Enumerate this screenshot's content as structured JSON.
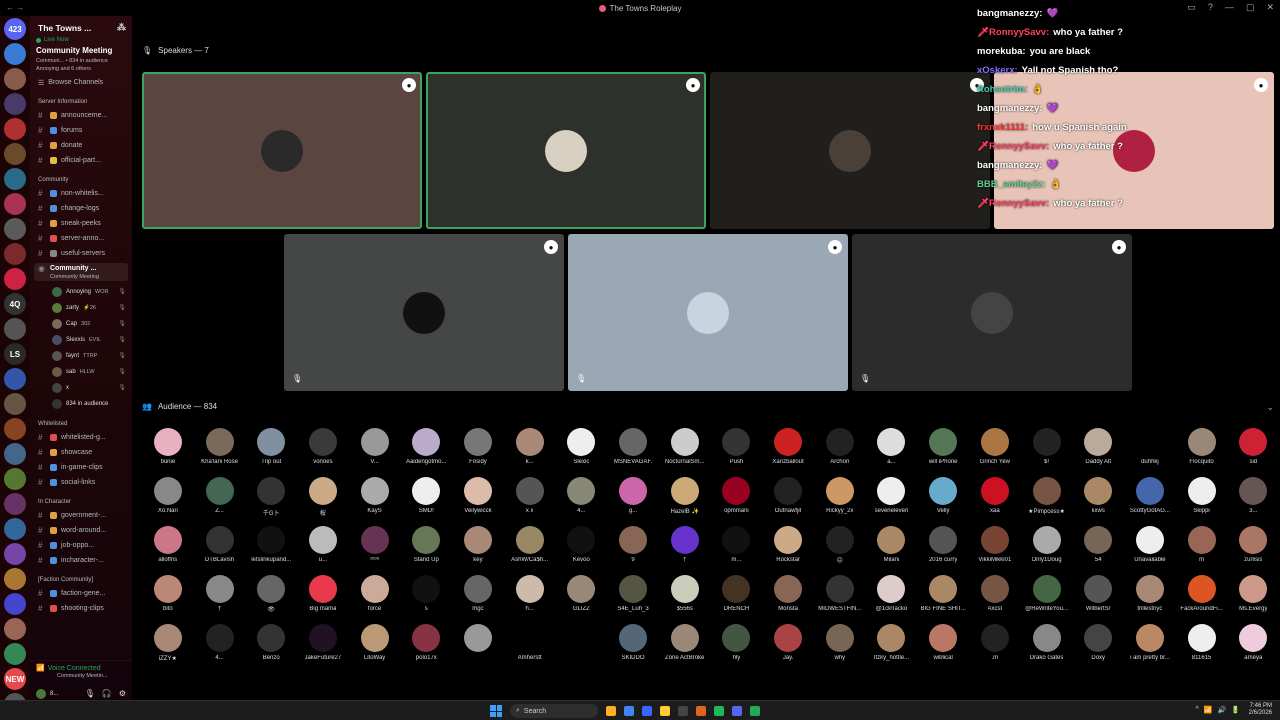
{
  "window": {
    "title": "The Towns Roleplay",
    "back": "←  →",
    "controls": [
      "▭",
      "?",
      "—",
      "▢",
      "✕"
    ]
  },
  "rail": [
    {
      "label": "423",
      "badge": "",
      "color": "#5865f2"
    },
    {
      "label": "",
      "badge": "",
      "color": "#3a7bd5"
    },
    {
      "label": "",
      "badge": "",
      "color": "#8a5a4a"
    },
    {
      "label": "",
      "badge": "",
      "color": "#4a3a6a"
    },
    {
      "label": "",
      "badge": "",
      "color": "#b03030"
    },
    {
      "label": "",
      "badge": "",
      "color": "#6a4a2a"
    },
    {
      "label": "",
      "badge": "",
      "color": "#2a6a8a"
    },
    {
      "label": "",
      "badge": "",
      "color": "#aa3355"
    },
    {
      "label": "",
      "badge": "",
      "color": "#5a5a5a"
    },
    {
      "label": "",
      "badge": "",
      "color": "#7a2a2a"
    },
    {
      "label": "",
      "badge": "",
      "color": "#cc2244"
    },
    {
      "label": "4Q",
      "badge": "",
      "color": "#333333"
    },
    {
      "label": "",
      "badge": "",
      "color": "#555555"
    },
    {
      "label": "LS",
      "badge": "",
      "color": "#2a2a2a"
    },
    {
      "label": "",
      "badge": "",
      "color": "#3355aa"
    },
    {
      "label": "",
      "badge": "",
      "color": "#665544"
    },
    {
      "label": "",
      "badge": "",
      "color": "#884422"
    },
    {
      "label": "",
      "badge": "",
      "color": "#446688"
    },
    {
      "label": "",
      "badge": "",
      "color": "#557733"
    },
    {
      "label": "",
      "badge": "",
      "color": "#663366"
    },
    {
      "label": "",
      "badge": "",
      "color": "#336699"
    },
    {
      "label": "",
      "badge": "",
      "color": "#7744aa"
    },
    {
      "label": "",
      "badge": "",
      "color": "#aa7733"
    },
    {
      "label": "",
      "badge": "",
      "color": "#4444cc"
    },
    {
      "label": "",
      "badge": "",
      "color": "#996655"
    },
    {
      "label": "",
      "badge": "",
      "color": "#338855"
    },
    {
      "label": "NEW",
      "badge": "",
      "color": "#e5484d"
    },
    {
      "label": "",
      "badge": "",
      "color": "#555555"
    }
  ],
  "sidebar": {
    "server_name": "The Towns ...",
    "live_now": "Live Now",
    "event_title": "Community Meeting",
    "event_sub": "Communi... • 834 in audience",
    "event_sub2": "Annoying and 6 others",
    "browse": "Browse Channels",
    "categories": [
      {
        "name": "Server Information",
        "channels": [
          {
            "name": "announceme...",
            "emo": "#e0a040"
          },
          {
            "name": "forums",
            "emo": "#5090e0"
          },
          {
            "name": "donate",
            "emo": "#e0a040"
          },
          {
            "name": "official-part...",
            "emo": "#e0c040"
          }
        ]
      },
      {
        "name": "Community",
        "channels": [
          {
            "name": "non-whitelis...",
            "emo": "#5090e0"
          },
          {
            "name": "change-logs",
            "emo": "#5090e0"
          },
          {
            "name": "sneak-peeks",
            "emo": "#e0a040"
          },
          {
            "name": "server-anno...",
            "emo": "#e05050"
          },
          {
            "name": "useful-servers",
            "emo": "#888888"
          }
        ]
      }
    ],
    "active_channel": {
      "name": "Community ...",
      "sub": "Community Meeting"
    },
    "voice_users": [
      {
        "name": "Annoying",
        "tag": "WOR"
      },
      {
        "name": "zarty",
        "tag": "⚡26"
      },
      {
        "name": "Cap",
        "tag": "302"
      },
      {
        "name": "Slexxis",
        "tag": "EVIL"
      },
      {
        "name": "faynt",
        "tag": "TTRP"
      },
      {
        "name": "sab",
        "tag": "HLLW"
      },
      {
        "name": "x",
        "tag": ""
      }
    ],
    "audience_count": "834 in audience",
    "categories2": [
      {
        "name": "Whitelisted",
        "channels": [
          {
            "name": "whitelisted-g...",
            "emo": "#e05050"
          },
          {
            "name": "showcase",
            "emo": "#e0a040"
          },
          {
            "name": "in-game-clips",
            "emo": "#5090e0"
          },
          {
            "name": "social-links",
            "emo": "#5090e0"
          }
        ]
      },
      {
        "name": "In Character",
        "channels": [
          {
            "name": "government-...",
            "emo": "#e0a040"
          },
          {
            "name": "word-around...",
            "emo": "#e0a040"
          },
          {
            "name": "job-oppo...",
            "emo": "#5090e0"
          },
          {
            "name": "incharacter-...",
            "emo": "#5090e0"
          }
        ]
      },
      {
        "name": "[Faction Community]",
        "channels": [
          {
            "name": "faction-gene...",
            "emo": "#5090e0"
          },
          {
            "name": "shooting-clips",
            "emo": "#e05050"
          }
        ]
      }
    ],
    "voice_connected": "Voice Connected",
    "voice_sub": "Community Meetin...",
    "user_name": "8...",
    "user_ctrls": [
      "🎙",
      "🎧",
      "⚙"
    ]
  },
  "stage": {
    "speakers_header": "Speakers — 7",
    "audience_header": "Audience — 834",
    "tiles": [
      {
        "bg": "#5a4540",
        "border": "#3ba55c",
        "av": "#2a2a2a"
      },
      {
        "bg": "#2e302c",
        "border": "#3ba55c",
        "av": "#d8d0c0"
      },
      {
        "bg": "#211f1b",
        "border": "transparent",
        "av": "#4a4038"
      },
      {
        "bg": "#e8c4b8",
        "border": "transparent",
        "av": "#b02040"
      },
      {
        "bg": "#454646",
        "border": "transparent",
        "av": "#111111"
      },
      {
        "bg": "#9aa7b5",
        "border": "transparent",
        "av": "#c8d4e0"
      },
      {
        "bg": "#2c2c2c",
        "border": "transparent",
        "av": "#444444"
      }
    ]
  },
  "chat": [
    {
      "user": "bangmanezzy:",
      "text": "💜",
      "color": "#ffffff"
    },
    {
      "user": "🗡RonnyySavv:",
      "text": "who ya father ?",
      "color": "#ff4060"
    },
    {
      "user": "morekuba:",
      "text": "you are black",
      "color": "#ffffff"
    },
    {
      "user": "xOskerx:",
      "text": "Yall not Spanish tho?",
      "color": "#8070ff"
    },
    {
      "user": "Rohsotrim:",
      "text": "👌",
      "color": "#40d0b0"
    },
    {
      "user": "bangmanezzy:",
      "text": "💜",
      "color": "#ffffff"
    },
    {
      "user": "frxnxk1111:",
      "text": "how u Spanish again",
      "color": "#ff3030"
    },
    {
      "user": "🗡RonnyySavv:",
      "text": "who ya father ?",
      "color": "#ff4060"
    },
    {
      "user": "bangmanezzy:",
      "text": "💜",
      "color": "#ffffff"
    },
    {
      "user": "BBB_smiley2z:",
      "text": "👌",
      "color": "#60d090"
    },
    {
      "user": "🗡RonnyySavv:",
      "text": "who ya father ?",
      "color": "#ff4060"
    }
  ],
  "audience": [
    [
      {
        "n": "bunie",
        "c": "#e8b0c0"
      },
      {
        "n": "Kha'lani Rose",
        "c": "#7a6a5a"
      },
      {
        "n": "Trip out",
        "c": "#8090a0"
      },
      {
        "n": "vonoes",
        "c": "#3a3a3a"
      },
      {
        "n": "V...",
        "c": "#999999"
      },
      {
        "n": "Aaidengotmo...",
        "c": "#bbaacc"
      },
      {
        "n": "Fosidy",
        "c": "#777777"
      },
      {
        "n": "k...",
        "c": "#aa8877"
      },
      {
        "n": "Slexic",
        "c": "#eeeeee"
      },
      {
        "n": "MSNEVAGAF.",
        "c": "#666666"
      },
      {
        "n": "NocturnalSm...",
        "c": "#cccccc"
      },
      {
        "n": "Push",
        "c": "#333333"
      },
      {
        "n": "Xanzballout",
        "c": "#cc2222"
      },
      {
        "n": "Archon",
        "c": "#222222"
      },
      {
        "n": "a...",
        "c": "#dddddd"
      },
      {
        "n": "will iPhone",
        "c": "#557755"
      },
      {
        "n": "Grinch Yew",
        "c": "#aa7744"
      },
      {
        "n": "$!",
        "c": "#222222"
      },
      {
        "n": "Daddy Alt",
        "c": "#bbaa99"
      },
      {
        "n": "duhhkj",
        "c": "#000000"
      },
      {
        "n": "Flocquito",
        "c": "#998877"
      },
      {
        "n": "sid",
        "c": "#cc2233"
      }
    ],
    [
      {
        "n": "Xo.Nari",
        "c": "#888888"
      },
      {
        "n": "Z...",
        "c": "#446655"
      },
      {
        "n": "千G卜",
        "c": "#333333"
      },
      {
        "n": "桜",
        "c": "#ccaa88"
      },
      {
        "n": "KayS",
        "c": "#aaaaaa"
      },
      {
        "n": "SMD!",
        "c": "#eeeeee"
      },
      {
        "n": "Veilywicck",
        "c": "#ddbbaa"
      },
      {
        "n": "x x",
        "c": "#555555"
      },
      {
        "n": "4...",
        "c": "#888877"
      },
      {
        "n": "g...",
        "c": "#cc66aa"
      },
      {
        "n": "HazelB ✨",
        "c": "#ccaa77"
      },
      {
        "n": "opmmani",
        "c": "#990022"
      },
      {
        "n": "Outnawfjit",
        "c": "#222222"
      },
      {
        "n": "Rickyy_2x",
        "c": "#cc9966"
      },
      {
        "n": "seveneleven",
        "c": "#eeeeee"
      },
      {
        "n": "Velly",
        "c": "#66aacc"
      },
      {
        "n": "xaa",
        "c": "#cc1122"
      },
      {
        "n": "★Pimpcess★",
        "c": "#775544"
      },
      {
        "n": "kxws",
        "c": "#aa8866"
      },
      {
        "n": "ScottyGotAG...",
        "c": "#4466aa"
      },
      {
        "n": "Skippi",
        "c": "#eeeeee"
      },
      {
        "n": "3...",
        "c": "#665555"
      }
    ],
    [
      {
        "n": "alloffris",
        "c": "#cc7788"
      },
      {
        "n": "DTBLavish",
        "c": "#333333"
      },
      {
        "n": "letslinkupand...",
        "c": "#111111"
      },
      {
        "n": "u...",
        "c": "#bbbbbb"
      },
      {
        "n": "ᶻᵉᵒᵘ",
        "c": "#663355"
      },
      {
        "n": "Stand Up",
        "c": "#667755"
      },
      {
        "n": "key",
        "c": "#aa8877"
      },
      {
        "n": "AshW/Ca$h...",
        "c": "#998866"
      },
      {
        "n": "Kevoo",
        "c": "#111111"
      },
      {
        "n": "9",
        "c": "#886655"
      },
      {
        "n": "†",
        "c": "#6633cc"
      },
      {
        "n": "m...",
        "c": "#111111"
      },
      {
        "n": "Rockstar",
        "c": "#ccaa88"
      },
      {
        "n": "☹",
        "c": "#222222"
      },
      {
        "n": "Milani",
        "c": "#aa8866"
      },
      {
        "n": "2016 curry",
        "c": "#555555"
      },
      {
        "n": "VikkiMikki01",
        "c": "#774433"
      },
      {
        "n": "Only1Doug",
        "c": "#aaaaaa"
      },
      {
        "n": "54",
        "c": "#776655"
      },
      {
        "n": "Unavailable",
        "c": "#eeeeee"
      },
      {
        "n": "m",
        "c": "#996655"
      },
      {
        "n": "zurlisis",
        "c": "#aa7766"
      }
    ],
    [
      {
        "n": "bito",
        "c": "#bb8877"
      },
      {
        "n": "†",
        "c": "#888888"
      },
      {
        "n": "👁",
        "c": "#666666"
      },
      {
        "n": "Big mama",
        "c": "#e83a4a"
      },
      {
        "n": "force",
        "c": "#ccaa99"
      },
      {
        "n": "s",
        "c": "#111111"
      },
      {
        "n": "mgc",
        "c": "#666666"
      },
      {
        "n": "h...",
        "c": "#ccbbaa"
      },
      {
        "n": "GLIZZ",
        "c": "#998877"
      },
      {
        "n": "S4E_Luh_3",
        "c": "#555544"
      },
      {
        "n": "$556s",
        "c": "#ccccbb"
      },
      {
        "n": "DRENCH",
        "c": "#443322"
      },
      {
        "n": "Monsta",
        "c": "#886655"
      },
      {
        "n": "MIDWESTFIN...",
        "c": "#333333"
      },
      {
        "n": "@1ck!Iacko",
        "c": "#ddcccc"
      },
      {
        "n": "BIG FINE SHIT...",
        "c": "#aa8866"
      },
      {
        "n": "Axcst",
        "c": "#775544"
      },
      {
        "n": "@ReWriteYou...",
        "c": "#446644"
      },
      {
        "n": "WilbertSr",
        "c": "#555555"
      },
      {
        "n": "trillestnyc",
        "c": "#aa8877"
      },
      {
        "n": "FackAroundFi...",
        "c": "#dd5522"
      },
      {
        "n": "Ms.Evergy",
        "c": "#cc9988"
      }
    ],
    [
      {
        "n": "iZZY★",
        "c": "#aa8877"
      },
      {
        "n": "4...",
        "c": "#222222"
      },
      {
        "n": "Benzo",
        "c": "#333333"
      },
      {
        "n": "JakeFuture27",
        "c": "#221122"
      },
      {
        "n": "LitoWay",
        "c": "#bb9977"
      },
      {
        "n": "polo17x",
        "c": "#883344"
      },
      {
        "n": "",
        "c": "#999999"
      },
      {
        "n": "Amherstt",
        "c": "#000000"
      },
      {
        "n": "",
        "c": "#000000"
      },
      {
        "n": "SKIDDO",
        "c": "#556677"
      },
      {
        "n": "Zone ActBroke",
        "c": "#998877"
      },
      {
        "n": "hly",
        "c": "#445544"
      },
      {
        "n": "Jay.",
        "c": "#aa4444"
      },
      {
        "n": "why",
        "c": "#776655"
      },
      {
        "n": "Itzky_hottle...",
        "c": "#aa8866"
      },
      {
        "n": "wiblical",
        "c": "#bb7766"
      },
      {
        "n": ".m",
        "c": "#222222"
      },
      {
        "n": "Drako Gates",
        "c": "#888888"
      },
      {
        "n": "Doxy",
        "c": "#444444"
      },
      {
        "n": "i am pretty br...",
        "c": "#bb8866"
      },
      {
        "n": "811615",
        "c": "#eeeeee"
      },
      {
        "n": "améya",
        "c": "#eeccdd"
      }
    ]
  ],
  "taskbar": {
    "search": "Search",
    "time": "7:46 PM",
    "date": "2/6/2026",
    "apps": [
      "#ffb020",
      "#4285f4",
      "#3a66ff",
      "#ffcc33",
      "#444444",
      "#dd6622",
      "#1db954",
      "#5865f2",
      "#22aa55"
    ],
    "tray": [
      "^",
      "📶",
      "🔊",
      "🔋"
    ]
  }
}
